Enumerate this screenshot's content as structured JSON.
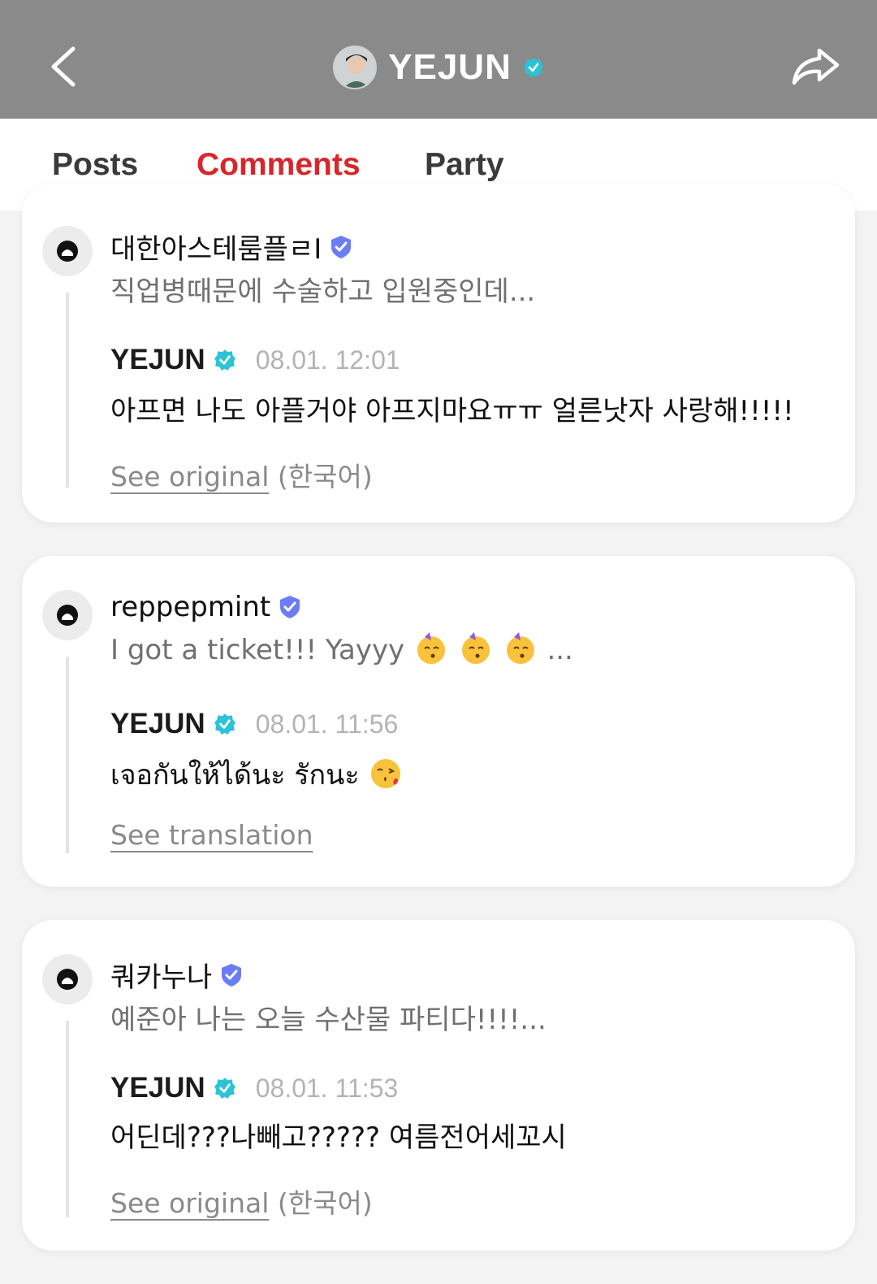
{
  "header": {
    "title": "YEJUN",
    "back_icon": "chevron-left-icon",
    "share_icon": "share-arrow-icon",
    "bg_color": "#8a8a8a",
    "verified_color": "#2bc3d6"
  },
  "tabs": [
    {
      "label": "Posts",
      "active": false
    },
    {
      "label": "Comments",
      "active": true
    },
    {
      "label": "Party",
      "active": false
    }
  ],
  "accent_color": "#d8262a",
  "comments": [
    {
      "user": "대한아스테룸플ㄹI",
      "preview": "직업병때문에 수술하고 입원중인데...",
      "reply_author": "YEJUN",
      "reply_time": "08.01. 12:01",
      "reply_text": "아프면 나도 아플거야 아프지마요ㅠㅠ 얼른낫자 사랑해!!!!!",
      "link_label": "See original",
      "link_suffix": "(한국어)"
    },
    {
      "user": "reppepmint",
      "preview": "I got a ticket!!! Yayyy",
      "preview_suffix": "...",
      "reply_author": "YEJUN",
      "reply_time": "08.01. 11:56",
      "reply_text": "เจอกันให้ได้นะ รักนะ",
      "link_label": "See translation",
      "link_suffix": ""
    },
    {
      "user": "쿼카누나",
      "preview": "예준아 나는 오늘 수산물 파티다!!!!...",
      "reply_author": "YEJUN",
      "reply_time": "08.01. 11:53",
      "reply_text": "어딘데???나빼고????? 여름전어세꼬시",
      "link_label": "See original",
      "link_suffix": "(한국어)"
    }
  ]
}
